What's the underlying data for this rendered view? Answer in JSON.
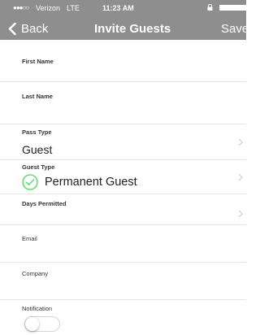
{
  "status_bar": {
    "signal": "●●●○○",
    "carrier": "Verizon",
    "network": "LTE",
    "time": "11:23 AM"
  },
  "nav": {
    "back_label": "Back",
    "title": "Invite Guests",
    "save_label": "Save"
  },
  "form": {
    "first_name": {
      "label": "First Name",
      "value": ""
    },
    "last_name": {
      "label": "Last Name",
      "value": ""
    },
    "pass_type": {
      "label": "Pass Type",
      "value": "Guest"
    },
    "guest_type": {
      "label": "Guest Type",
      "value": "Permanent Guest"
    },
    "days_permitted": {
      "label": "Days Permitted",
      "value": ""
    },
    "email": {
      "label": "Email",
      "value": ""
    },
    "company": {
      "label": "Company",
      "value": ""
    },
    "notification": {
      "label": "Notification",
      "enabled": false
    }
  },
  "colors": {
    "header_bg": "#8e8e8e",
    "check_accent": "#4cd964",
    "divider": "#e6e6e6"
  }
}
